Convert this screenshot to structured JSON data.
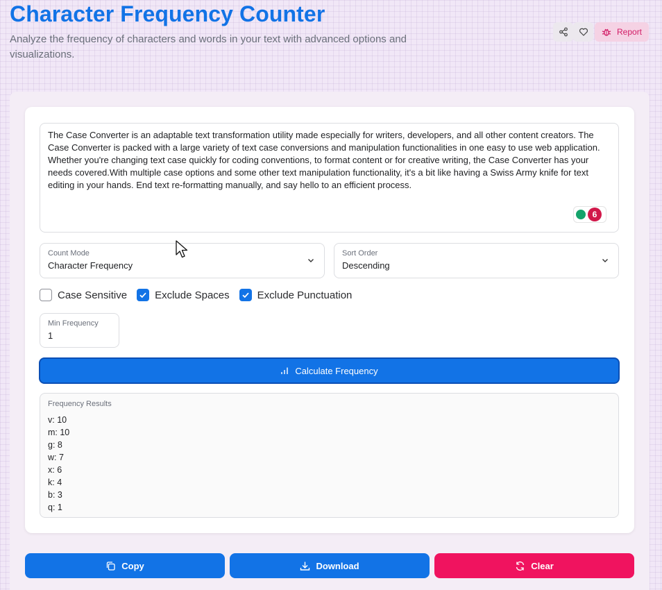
{
  "header": {
    "title": "Character Frequency Counter",
    "subtitle": "Analyze the frequency of characters and words in your text with advanced options and visualizations.",
    "report_label": "Report"
  },
  "input": {
    "text": "The Case Converter is an adaptable text transformation utility made especially for writers, developers, and all other content creators. The Case Converter is packed with a large variety of text case conversions and manipulation functionalities in one easy to use web application. Whether you're changing text case quickly for coding conventions, to format content or for creative writing, the Case Converter has your needs covered.With multiple case options and some other text manipulation functionality, it's a bit like having a Swiss Army knife for text editing in your hands. End text re-formatting manually, and say hello to an efficient process.",
    "extension_badge_count": "6"
  },
  "count_mode": {
    "label": "Count Mode",
    "value": "Character Frequency"
  },
  "sort_order": {
    "label": "Sort Order",
    "value": "Descending"
  },
  "options": [
    {
      "label": "Case Sensitive",
      "checked": false
    },
    {
      "label": "Exclude Spaces",
      "checked": true
    },
    {
      "label": "Exclude Punctuation",
      "checked": true
    }
  ],
  "min_frequency": {
    "label": "Min Frequency",
    "value": "1"
  },
  "calculate_label": "Calculate Frequency",
  "results": {
    "label": "Frequency Results",
    "lines": [
      "v: 10",
      "m: 10",
      "g: 8",
      "w: 7",
      "x: 6",
      "k: 4",
      "b: 3",
      "q: 1"
    ]
  },
  "buttons": {
    "copy": "Copy",
    "download": "Download",
    "clear": "Clear"
  },
  "colors": {
    "primary": "#1273e6",
    "danger": "#f0135f",
    "report_text": "#d21c66"
  }
}
